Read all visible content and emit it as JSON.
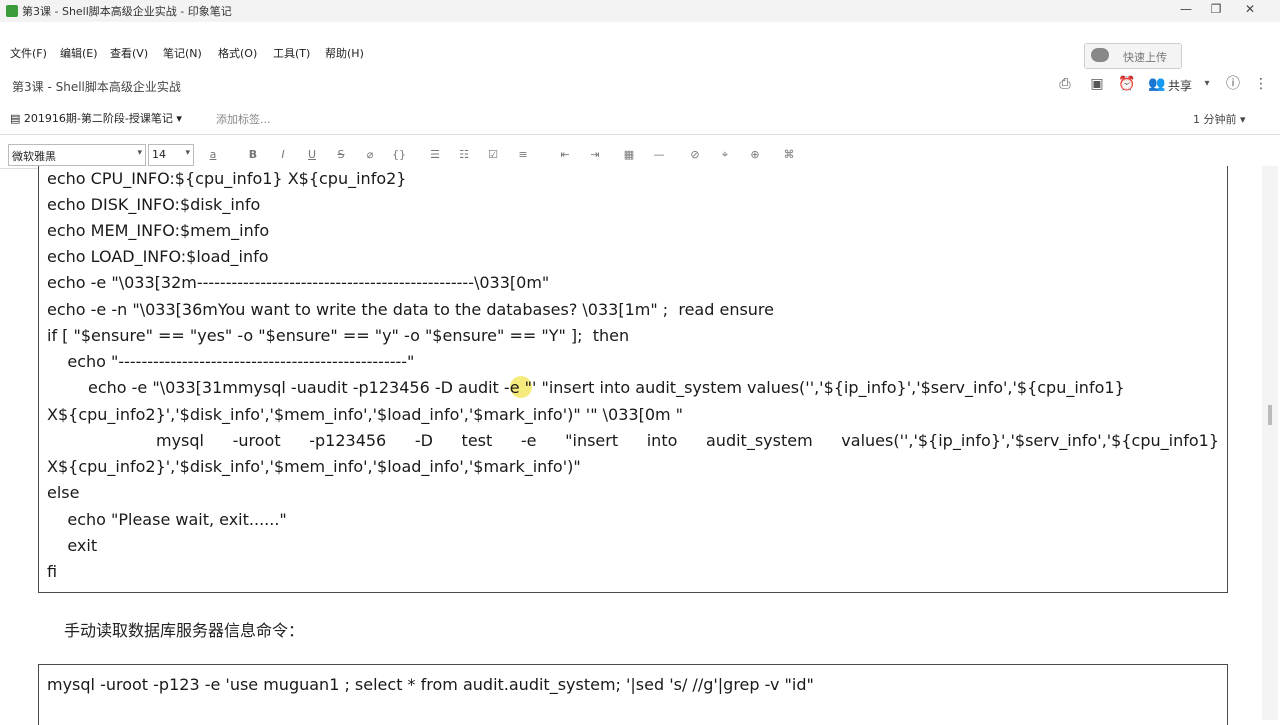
{
  "window": {
    "title": "第3课 - Shell脚本高级企业实战 - 印象笔记",
    "controls": [
      "—",
      "❐",
      "✕"
    ]
  },
  "menu": [
    "文件(F)",
    "编辑(E)",
    "查看(V)",
    "笔记(N)",
    "格式(O)",
    "工具(T)",
    "帮助(H)"
  ],
  "sync_button": "快速上传",
  "note_path": "第3课 - Shell脚本高级企业实战",
  "actions": {
    "share": "共享"
  },
  "notebook": "201916期-第二阶段-授课笔记",
  "add_tag": "添加标签...",
  "updated": "1 分钟前",
  "toolbar": {
    "font_family": "微软雅黑",
    "font_size": "14",
    "buttons": [
      "a",
      "B",
      "I",
      "U",
      "S",
      "⌀",
      "{}",
      "☰",
      "☷",
      "☑",
      "≡",
      "⇤",
      "⇥",
      "▦",
      "—",
      "⊘",
      "⌖",
      "⊕",
      "⌘"
    ]
  },
  "code_lines": [
    "echo CPU_INFO:${cpu_info1} X${cpu_info2}",
    "echo DISK_INFO:$disk_info",
    "echo MEM_INFO:$mem_info",
    "echo LOAD_INFO:$load_info",
    "echo -e \"\\033[32m------------------------------------------------\\033[0m\"",
    "echo -e -n \"\\033[36mYou want to write the data to the databases? \\033[1m\" ;  read ensure",
    "if [ \"$ensure\" == \"yes\" -o \"$ensure\" == \"y\" -o \"$ensure\" == \"Y\" ];  then",
    "    echo \"--------------------------------------------------\"",
    "echo -e \"\\033[31mmysql -uaudit -p123456 -D audit -e \"' \"insert into audit_system values('','${ip_info}','$serv_info','${cpu_info1}",
    "X${cpu_info2}','$disk_info','$mem_info','$load_info','$mark_info')\" '\" \\033[0m \"",
    "mysql -uroot -p123456 -D test -e \"insert into audit_system values('','${ip_info}','$serv_info','${cpu_info1}",
    "X${cpu_info2}','$disk_info','$mem_info','$load_info','$mark_info')\"",
    "else",
    "    echo \"Please wait, exit......\"",
    "    exit",
    "fi"
  ],
  "paragraph": "手动读取数据库服务器信息命令：",
  "code2_line": "mysql -uroot -p123 -e 'use muguan1 ; select * from audit.audit_system; '|sed 's/ //g'|grep -v \"id\""
}
